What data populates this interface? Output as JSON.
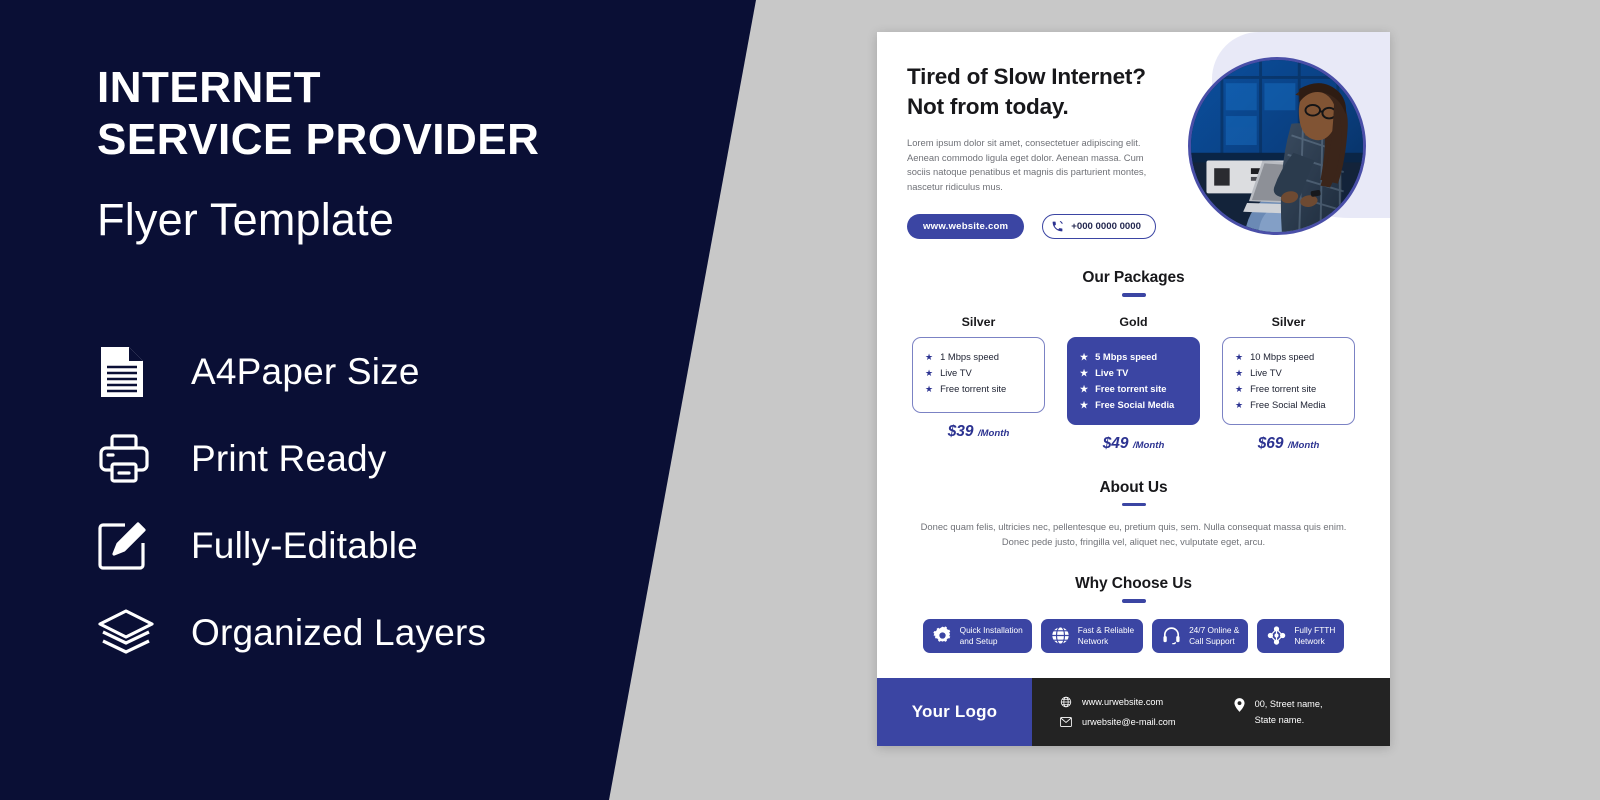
{
  "promo": {
    "title_line1": "INTERNET",
    "title_line2": "SERVICE PROVIDER",
    "subtitle": "Flyer Template",
    "features": [
      {
        "icon": "document-icon",
        "label": "A4Paper Size"
      },
      {
        "icon": "printer-icon",
        "label": "Print Ready"
      },
      {
        "icon": "pencil-edit-icon",
        "label": "Fully-Editable"
      },
      {
        "icon": "layers-icon",
        "label": "Organized Layers"
      }
    ]
  },
  "flyer": {
    "hero": {
      "headline_line1": "Tired of Slow Internet?",
      "headline_line2": "Not from today.",
      "paragraph": "Lorem ipsum dolor sit amet, consectetuer adipiscing elit. Aenean commodo ligula eget dolor. Aenean massa. Cum sociis natoque penatibus et magnis dis parturient montes, nascetur ridiculus mus.",
      "website_button": "www.website.com",
      "phone_button": "+000 0000 0000",
      "image_alt": "woman-with-laptop-photo"
    },
    "packages": {
      "heading": "Our Packages",
      "items": [
        {
          "name": "Silver",
          "featured": false,
          "features": [
            "1 Mbps speed",
            "Live TV",
            "Free torrent site"
          ],
          "price": "$39",
          "period": "/Month"
        },
        {
          "name": "Gold",
          "featured": true,
          "features": [
            "5 Mbps speed",
            "Live TV",
            "Free torrent site",
            "Free Social Media"
          ],
          "price": "$49",
          "period": "/Month"
        },
        {
          "name": "Silver",
          "featured": false,
          "features": [
            "10 Mbps speed",
            "Live TV",
            "Free torrent site",
            "Free Social Media"
          ],
          "price": "$69",
          "period": "/Month"
        }
      ]
    },
    "about": {
      "heading": "About Us",
      "paragraph": "Donec quam felis, ultricies nec, pellentesque eu, pretium quis, sem. Nulla consequat massa quis enim. Donec pede justo, fringilla vel, aliquet nec, vulputate eget, arcu."
    },
    "why": {
      "heading": "Why Choose Us",
      "items": [
        {
          "icon": "gear-icon",
          "line1": "Quick Installation",
          "line2": "and Setup"
        },
        {
          "icon": "globe-icon",
          "line1": "Fast & Reliable",
          "line2": "Network"
        },
        {
          "icon": "headset-icon",
          "line1": "24/7 Online &",
          "line2": "Call Support"
        },
        {
          "icon": "network-icon",
          "line1": "Fully FTTH",
          "line2": "Network"
        }
      ]
    },
    "footer": {
      "logo": "Your Logo",
      "website": "www.urwebsite.com",
      "email": "urwebsite@e-mail.com",
      "address_line1": "00, Street name,",
      "address_line2": "State name."
    }
  },
  "colors": {
    "dark_navy": "#0a0f35",
    "brand_blue": "#3b45a3",
    "accent_blue": "#2c3391",
    "page_bg": "#c8c8c8",
    "footer_dark": "#232323",
    "blob_lavender": "#e8e9f7"
  }
}
